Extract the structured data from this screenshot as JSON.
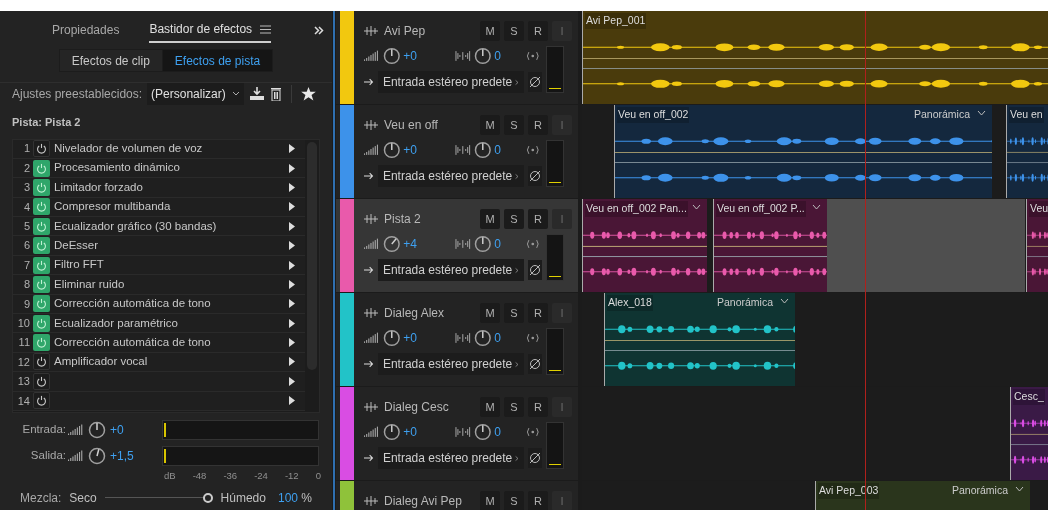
{
  "panel": {
    "tabs": [
      {
        "label": "Propiedades",
        "selected": false
      },
      {
        "label": "Bastidor de efectos",
        "selected": true
      }
    ],
    "subtabs": [
      {
        "label": "Efectos de clip",
        "selected": false
      },
      {
        "label": "Efectos de pista",
        "selected": true
      }
    ],
    "preset_label": "Ajustes preestablecidos:",
    "preset_value": "(Personalizar)",
    "track_label": "Pista: Pista 2",
    "effects": [
      {
        "number": "1",
        "name": "Nivelador de volumen de voz",
        "on": false
      },
      {
        "number": "2",
        "name": "Procesamiento dinámico",
        "on": true
      },
      {
        "number": "3",
        "name": "Limitador forzado",
        "on": true
      },
      {
        "number": "4",
        "name": "Compresor multibanda",
        "on": true
      },
      {
        "number": "5",
        "name": "Ecualizador gráfico (30 bandas)",
        "on": true
      },
      {
        "number": "6",
        "name": "DeEsser",
        "on": true
      },
      {
        "number": "7",
        "name": "Filtro FFT",
        "on": true
      },
      {
        "number": "8",
        "name": "Eliminar ruido",
        "on": true
      },
      {
        "number": "9",
        "name": "Corrección automática de tono",
        "on": true
      },
      {
        "number": "10",
        "name": "Ecualizador paramétrico",
        "on": true
      },
      {
        "number": "11",
        "name": "Corrección automática de tono",
        "on": true
      },
      {
        "number": "12",
        "name": "Amplificador vocal",
        "on": false
      },
      {
        "number": "13",
        "on": false
      },
      {
        "number": "14",
        "on": false
      }
    ],
    "gains": [
      {
        "label": "Entrada:",
        "value": "+0"
      },
      {
        "label": "Salida:",
        "value": "+1,5"
      }
    ],
    "scale": [
      "dB",
      "-48",
      "-36",
      "-24",
      "-12",
      "0"
    ],
    "mix": {
      "label": "Mezcla:",
      "dry": "Seco",
      "wet": "Húmedo",
      "value": "100",
      "unit": "%",
      "level": 1
    }
  },
  "tracks": [
    {
      "name": "Avi Pep",
      "color": "#f2c80f",
      "selected": false,
      "volume": "+0",
      "pan": "0",
      "input": "Entrada estéreo predete",
      "buttons": [
        {
          "label": "M",
          "disabled": false
        },
        {
          "label": "S",
          "disabled": false
        },
        {
          "label": "R",
          "disabled": false
        },
        {
          "label": "I",
          "disabled": true
        }
      ],
      "clips": [
        {
          "title": "Avi Pep_001"
        }
      ]
    },
    {
      "name": "Veu en off",
      "color": "#3d92ea",
      "selected": false,
      "volume": "+0",
      "pan": "0",
      "input": "Entrada estéreo predete",
      "buttons": [
        {
          "label": "M",
          "disabled": false
        },
        {
          "label": "S",
          "disabled": false
        },
        {
          "label": "R",
          "disabled": false
        },
        {
          "label": "I",
          "disabled": true
        }
      ],
      "clips": [
        {
          "title": "Veu en off_002",
          "pan_label": "Panorámica"
        },
        {
          "title": "Veu en"
        }
      ]
    },
    {
      "name": "Pista 2",
      "color": "#e95aab",
      "selected": true,
      "volume": "+4",
      "pan": "0",
      "input": "Entrada estéreo predete",
      "buttons": [
        {
          "label": "M",
          "disabled": false
        },
        {
          "label": "S",
          "disabled": false
        },
        {
          "label": "R",
          "disabled": false
        },
        {
          "label": "I",
          "disabled": true
        }
      ],
      "clips": [
        {
          "title": "Veu en off_002 Pan...",
          "menu": true
        },
        {
          "title": "Veu en off_002 P...",
          "menu": true
        },
        {
          "title": "Veu"
        }
      ]
    },
    {
      "name": "Dialeg Alex",
      "color": "#22c3c8",
      "selected": false,
      "volume": "+0",
      "pan": "0",
      "input": "Entrada estéreo predete",
      "buttons": [
        {
          "label": "M",
          "disabled": false
        },
        {
          "label": "S",
          "disabled": false
        },
        {
          "label": "R",
          "disabled": false
        },
        {
          "label": "I",
          "disabled": true
        }
      ],
      "clips": [
        {
          "title": "Alex_018",
          "pan_label": "Panorámica"
        }
      ]
    },
    {
      "name": "Dialeg Cesc",
      "color": "#d94de3",
      "selected": false,
      "volume": "+0",
      "pan": "0",
      "input": "Entrada estéreo predete",
      "buttons": [
        {
          "label": "M",
          "disabled": false
        },
        {
          "label": "S",
          "disabled": false
        },
        {
          "label": "R",
          "disabled": false
        },
        {
          "label": "I",
          "disabled": true
        }
      ],
      "clips": [
        {
          "title": "Cesc_"
        }
      ]
    },
    {
      "name": "Dialeg Avi Pep",
      "color": "#8fc23a",
      "selected": false,
      "buttons": [
        {
          "label": "M",
          "disabled": false
        },
        {
          "label": "S",
          "disabled": false
        },
        {
          "label": "R",
          "disabled": false
        },
        {
          "label": "I",
          "disabled": true
        }
      ],
      "clips": [
        {
          "title": "Avi Pep_003",
          "pan_label": "Panorámica"
        }
      ]
    }
  ]
}
